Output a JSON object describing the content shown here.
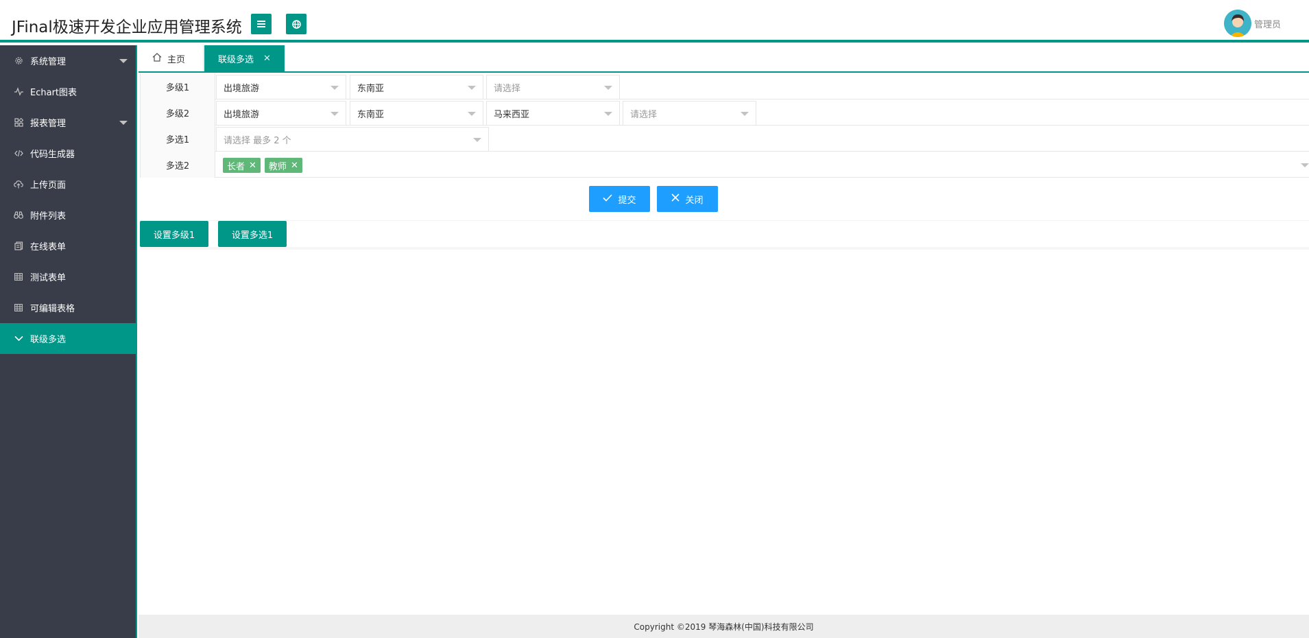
{
  "header": {
    "title": "JFinal极速开发企业应用管理系统",
    "user_name": "管理员",
    "accent_color": "#009688"
  },
  "sidebar": {
    "items": [
      {
        "label": "系统管理",
        "icon": "gear-icon",
        "has_caret": true
      },
      {
        "label": "Echart图表",
        "icon": "pulse-icon",
        "has_caret": false
      },
      {
        "label": "报表管理",
        "icon": "app-grid-icon",
        "has_caret": true
      },
      {
        "label": "代码生成器",
        "icon": "code-icon",
        "has_caret": false
      },
      {
        "label": "上传页面",
        "icon": "cloud-upload-icon",
        "has_caret": false
      },
      {
        "label": "附件列表",
        "icon": "binoculars-icon",
        "has_caret": false
      },
      {
        "label": "在线表单",
        "icon": "form-icon",
        "has_caret": false
      },
      {
        "label": "测试表单",
        "icon": "table-icon",
        "has_caret": false
      },
      {
        "label": "可编辑表格",
        "icon": "table-icon",
        "has_caret": false
      },
      {
        "label": "联级多选",
        "icon": "chevron-down-icon",
        "has_caret": false,
        "active": true
      }
    ]
  },
  "tabs": {
    "home_label": "主页",
    "current_label": "联级多选",
    "close_glyph": "✕"
  },
  "form": {
    "row1": {
      "label": "多级1",
      "sel1": "出境旅游",
      "sel2": "东南亚",
      "sel3_placeholder": "请选择"
    },
    "row2": {
      "label": "多级2",
      "sel1": "出境旅游",
      "sel2": "东南亚",
      "sel3": "马来西亚",
      "sel4_placeholder": "请选择"
    },
    "row3": {
      "label": "多选1",
      "placeholder": "请选择 最多 2 个"
    },
    "row4": {
      "label": "多选2",
      "tags": [
        "长者",
        "教师"
      ],
      "tag_close": "✕"
    }
  },
  "buttons": {
    "submit": "提交",
    "close": "关闭",
    "set_multi1": "设置多级1",
    "set_select1": "设置多选1"
  },
  "footer": {
    "copyright": "Copyright ©2019 琴海森林(中国)科技有限公司"
  }
}
